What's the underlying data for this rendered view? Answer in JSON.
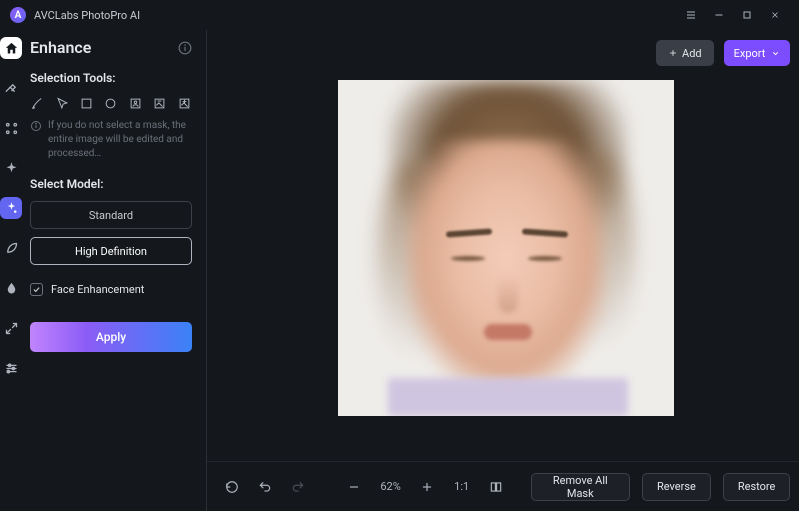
{
  "app_title": "AVCLabs PhotoPro AI",
  "header": {
    "add_label": "Add",
    "export_label": "Export"
  },
  "panel": {
    "title": "Enhance",
    "section_tools": "Selection Tools:",
    "hint": "If you do not select a mask, the entire image will be edited and processed…",
    "section_model": "Select Model:",
    "model_standard": "Standard",
    "model_hd": "High Definition",
    "face_enhancement": "Face Enhancement",
    "apply_label": "Apply"
  },
  "toolbar": {
    "zoom": "62%",
    "fit_label": "1:1"
  },
  "actions": {
    "remove_mask": "Remove All Mask",
    "reverse": "Reverse",
    "restore": "Restore"
  },
  "rail_items": [
    "home",
    "remove-bg",
    "magic-select",
    "sparkle",
    "palette",
    "colorize",
    "crop",
    "settings"
  ]
}
